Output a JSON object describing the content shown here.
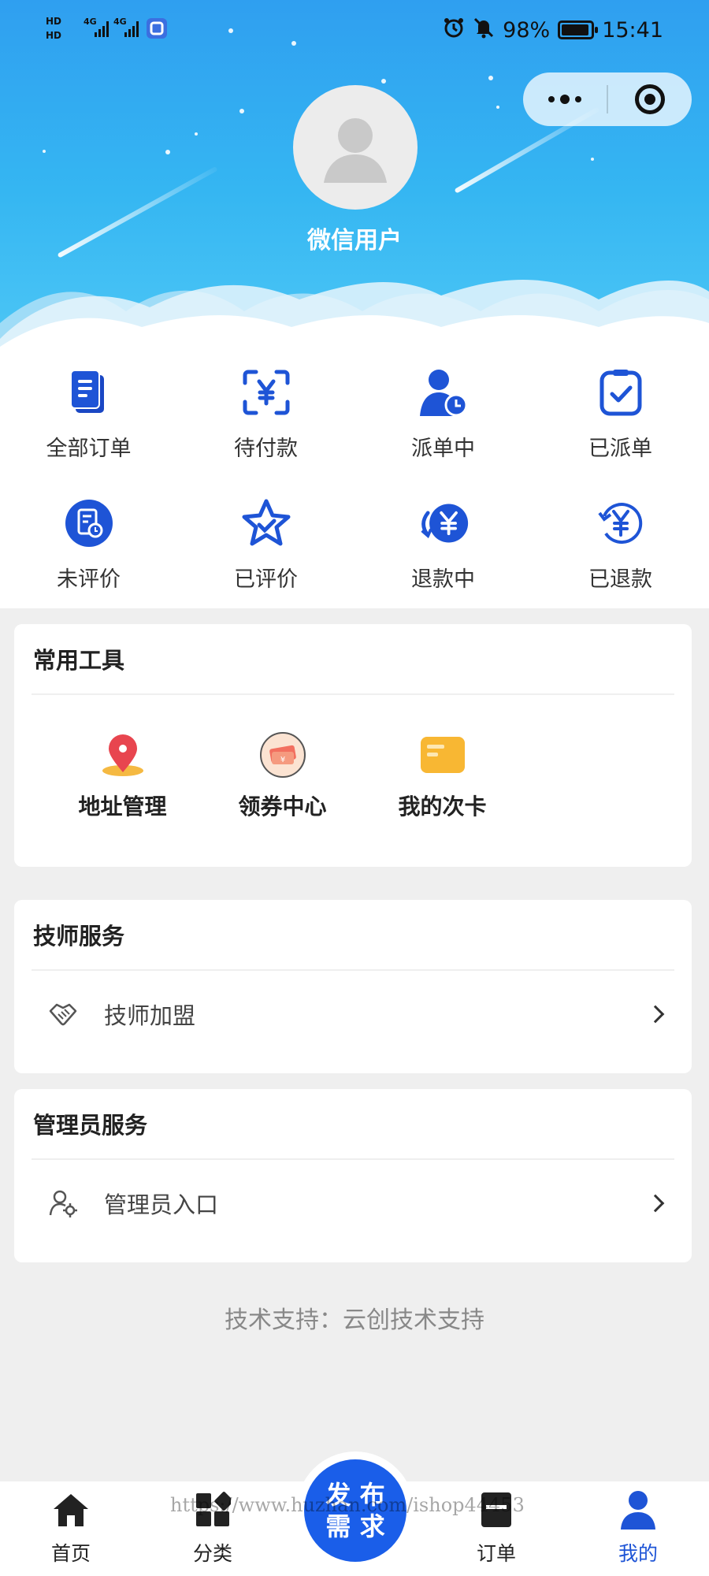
{
  "statusbar": {
    "network_left": "HD",
    "battery": "98%",
    "time": "15:41"
  },
  "profile": {
    "username": "微信用户"
  },
  "orders": [
    {
      "label": "全部订单",
      "icon": "document-icon"
    },
    {
      "label": "待付款",
      "icon": "scan-yen-icon"
    },
    {
      "label": "派单中",
      "icon": "user-clock-icon"
    },
    {
      "label": "已派单",
      "icon": "clipboard-check-icon"
    },
    {
      "label": "未评价",
      "icon": "note-clock-icon"
    },
    {
      "label": "已评价",
      "icon": "star-check-icon"
    },
    {
      "label": "退款中",
      "icon": "yen-return-icon"
    },
    {
      "label": "已退款",
      "icon": "yen-refund-icon"
    }
  ],
  "tools": {
    "title": "常用工具",
    "items": [
      {
        "label": "地址管理",
        "icon": "location-pin-icon"
      },
      {
        "label": "领券中心",
        "icon": "coupon-icon"
      },
      {
        "label": "我的次卡",
        "icon": "card-icon"
      }
    ]
  },
  "technician": {
    "title": "技师服务",
    "item_label": "技师加盟",
    "icon": "handshake-icon"
  },
  "admin": {
    "title": "管理员服务",
    "item_label": "管理员入口",
    "icon": "admin-gear-icon"
  },
  "support_text": "技术支持：云创技术支持",
  "tabbar": {
    "items": [
      {
        "label": "首页",
        "icon": "home-icon"
      },
      {
        "label": "分类",
        "icon": "category-icon"
      },
      {
        "label": "订单",
        "icon": "order-icon"
      },
      {
        "label": "我的",
        "icon": "user-icon"
      }
    ],
    "publish_line1": "发 布",
    "publish_line2": "需 求",
    "active": "我的"
  },
  "watermark": "https://www.huzhan.com/ishop44453",
  "colors": {
    "primary": "#1e54d6",
    "header": "#35b6f2",
    "publish": "#1a5ee9"
  }
}
